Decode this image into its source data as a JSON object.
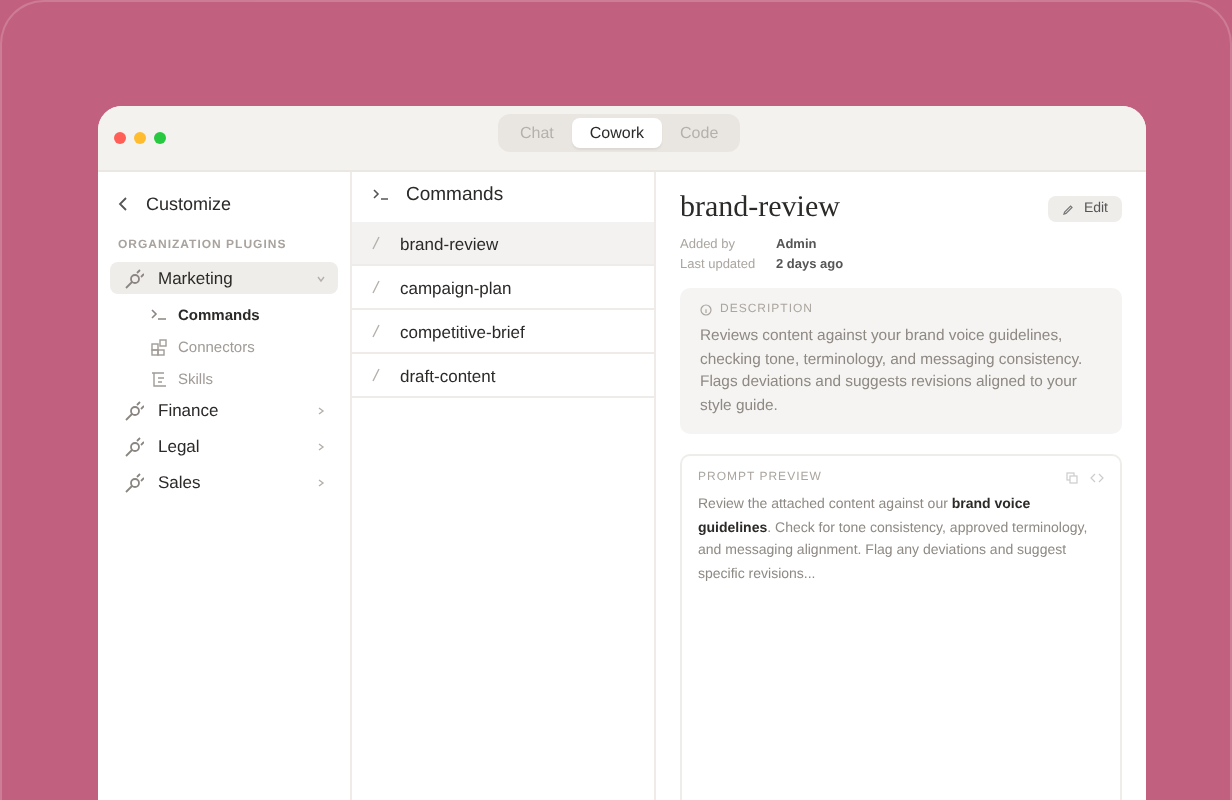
{
  "tabs": [
    {
      "label": "Chat",
      "selected": false
    },
    {
      "label": "Cowork",
      "selected": true
    },
    {
      "label": "Code",
      "selected": false
    }
  ],
  "sidebar": {
    "back_label": "Customize",
    "section": "ORGANIZATION PLUGINS",
    "items": [
      {
        "label": "Marketing",
        "selected": true,
        "expanded": true,
        "children": [
          {
            "label": "Commands",
            "kind": "commands",
            "selected": true
          },
          {
            "label": "Connectors",
            "kind": "connectors",
            "selected": false
          },
          {
            "label": "Skills",
            "kind": "skills",
            "selected": false
          }
        ]
      },
      {
        "label": "Finance",
        "selected": false,
        "expanded": false
      },
      {
        "label": "Legal",
        "selected": false,
        "expanded": false
      },
      {
        "label": "Sales",
        "selected": false,
        "expanded": false
      }
    ]
  },
  "commands": {
    "title": "Commands",
    "items": [
      {
        "label": "brand-review",
        "selected": true
      },
      {
        "label": "campaign-plan",
        "selected": false
      },
      {
        "label": "competitive-brief",
        "selected": false
      },
      {
        "label": "draft-content",
        "selected": false
      }
    ]
  },
  "detail": {
    "title": "brand-review",
    "edit_button": "Edit",
    "meta": [
      {
        "label": "Added by",
        "value": "Admin"
      },
      {
        "label": "Last updated",
        "value": "2 days ago"
      }
    ],
    "description": {
      "heading": "DESCRIPTION",
      "text": "Reviews content against your brand voice guidelines, checking tone, terminology, and messaging consistency. Flags deviations and suggests revisions aligned to your style guide."
    },
    "prompt_preview": {
      "heading": "PROMPT PREVIEW",
      "text": "Review the attached content against our **brand voice guidelines**. Check for tone consistency, approved terminology, and messaging alignment. Flag any deviations and suggest specific revisions..."
    }
  }
}
